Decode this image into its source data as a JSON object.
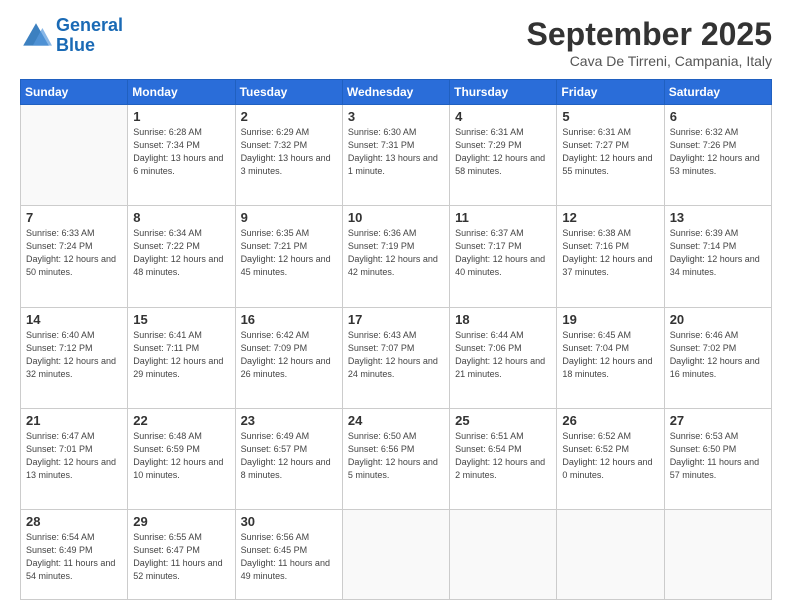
{
  "logo": {
    "line1": "General",
    "line2": "Blue"
  },
  "title": "September 2025",
  "location": "Cava De Tirreni, Campania, Italy",
  "days_of_week": [
    "Sunday",
    "Monday",
    "Tuesday",
    "Wednesday",
    "Thursday",
    "Friday",
    "Saturday"
  ],
  "weeks": [
    [
      {
        "day": "",
        "sunrise": "",
        "sunset": "",
        "daylight": ""
      },
      {
        "day": "1",
        "sunrise": "Sunrise: 6:28 AM",
        "sunset": "Sunset: 7:34 PM",
        "daylight": "Daylight: 13 hours and 6 minutes."
      },
      {
        "day": "2",
        "sunrise": "Sunrise: 6:29 AM",
        "sunset": "Sunset: 7:32 PM",
        "daylight": "Daylight: 13 hours and 3 minutes."
      },
      {
        "day": "3",
        "sunrise": "Sunrise: 6:30 AM",
        "sunset": "Sunset: 7:31 PM",
        "daylight": "Daylight: 13 hours and 1 minute."
      },
      {
        "day": "4",
        "sunrise": "Sunrise: 6:31 AM",
        "sunset": "Sunset: 7:29 PM",
        "daylight": "Daylight: 12 hours and 58 minutes."
      },
      {
        "day": "5",
        "sunrise": "Sunrise: 6:31 AM",
        "sunset": "Sunset: 7:27 PM",
        "daylight": "Daylight: 12 hours and 55 minutes."
      },
      {
        "day": "6",
        "sunrise": "Sunrise: 6:32 AM",
        "sunset": "Sunset: 7:26 PM",
        "daylight": "Daylight: 12 hours and 53 minutes."
      }
    ],
    [
      {
        "day": "7",
        "sunrise": "Sunrise: 6:33 AM",
        "sunset": "Sunset: 7:24 PM",
        "daylight": "Daylight: 12 hours and 50 minutes."
      },
      {
        "day": "8",
        "sunrise": "Sunrise: 6:34 AM",
        "sunset": "Sunset: 7:22 PM",
        "daylight": "Daylight: 12 hours and 48 minutes."
      },
      {
        "day": "9",
        "sunrise": "Sunrise: 6:35 AM",
        "sunset": "Sunset: 7:21 PM",
        "daylight": "Daylight: 12 hours and 45 minutes."
      },
      {
        "day": "10",
        "sunrise": "Sunrise: 6:36 AM",
        "sunset": "Sunset: 7:19 PM",
        "daylight": "Daylight: 12 hours and 42 minutes."
      },
      {
        "day": "11",
        "sunrise": "Sunrise: 6:37 AM",
        "sunset": "Sunset: 7:17 PM",
        "daylight": "Daylight: 12 hours and 40 minutes."
      },
      {
        "day": "12",
        "sunrise": "Sunrise: 6:38 AM",
        "sunset": "Sunset: 7:16 PM",
        "daylight": "Daylight: 12 hours and 37 minutes."
      },
      {
        "day": "13",
        "sunrise": "Sunrise: 6:39 AM",
        "sunset": "Sunset: 7:14 PM",
        "daylight": "Daylight: 12 hours and 34 minutes."
      }
    ],
    [
      {
        "day": "14",
        "sunrise": "Sunrise: 6:40 AM",
        "sunset": "Sunset: 7:12 PM",
        "daylight": "Daylight: 12 hours and 32 minutes."
      },
      {
        "day": "15",
        "sunrise": "Sunrise: 6:41 AM",
        "sunset": "Sunset: 7:11 PM",
        "daylight": "Daylight: 12 hours and 29 minutes."
      },
      {
        "day": "16",
        "sunrise": "Sunrise: 6:42 AM",
        "sunset": "Sunset: 7:09 PM",
        "daylight": "Daylight: 12 hours and 26 minutes."
      },
      {
        "day": "17",
        "sunrise": "Sunrise: 6:43 AM",
        "sunset": "Sunset: 7:07 PM",
        "daylight": "Daylight: 12 hours and 24 minutes."
      },
      {
        "day": "18",
        "sunrise": "Sunrise: 6:44 AM",
        "sunset": "Sunset: 7:06 PM",
        "daylight": "Daylight: 12 hours and 21 minutes."
      },
      {
        "day": "19",
        "sunrise": "Sunrise: 6:45 AM",
        "sunset": "Sunset: 7:04 PM",
        "daylight": "Daylight: 12 hours and 18 minutes."
      },
      {
        "day": "20",
        "sunrise": "Sunrise: 6:46 AM",
        "sunset": "Sunset: 7:02 PM",
        "daylight": "Daylight: 12 hours and 16 minutes."
      }
    ],
    [
      {
        "day": "21",
        "sunrise": "Sunrise: 6:47 AM",
        "sunset": "Sunset: 7:01 PM",
        "daylight": "Daylight: 12 hours and 13 minutes."
      },
      {
        "day": "22",
        "sunrise": "Sunrise: 6:48 AM",
        "sunset": "Sunset: 6:59 PM",
        "daylight": "Daylight: 12 hours and 10 minutes."
      },
      {
        "day": "23",
        "sunrise": "Sunrise: 6:49 AM",
        "sunset": "Sunset: 6:57 PM",
        "daylight": "Daylight: 12 hours and 8 minutes."
      },
      {
        "day": "24",
        "sunrise": "Sunrise: 6:50 AM",
        "sunset": "Sunset: 6:56 PM",
        "daylight": "Daylight: 12 hours and 5 minutes."
      },
      {
        "day": "25",
        "sunrise": "Sunrise: 6:51 AM",
        "sunset": "Sunset: 6:54 PM",
        "daylight": "Daylight: 12 hours and 2 minutes."
      },
      {
        "day": "26",
        "sunrise": "Sunrise: 6:52 AM",
        "sunset": "Sunset: 6:52 PM",
        "daylight": "Daylight: 12 hours and 0 minutes."
      },
      {
        "day": "27",
        "sunrise": "Sunrise: 6:53 AM",
        "sunset": "Sunset: 6:50 PM",
        "daylight": "Daylight: 11 hours and 57 minutes."
      }
    ],
    [
      {
        "day": "28",
        "sunrise": "Sunrise: 6:54 AM",
        "sunset": "Sunset: 6:49 PM",
        "daylight": "Daylight: 11 hours and 54 minutes."
      },
      {
        "day": "29",
        "sunrise": "Sunrise: 6:55 AM",
        "sunset": "Sunset: 6:47 PM",
        "daylight": "Daylight: 11 hours and 52 minutes."
      },
      {
        "day": "30",
        "sunrise": "Sunrise: 6:56 AM",
        "sunset": "Sunset: 6:45 PM",
        "daylight": "Daylight: 11 hours and 49 minutes."
      },
      {
        "day": "",
        "sunrise": "",
        "sunset": "",
        "daylight": ""
      },
      {
        "day": "",
        "sunrise": "",
        "sunset": "",
        "daylight": ""
      },
      {
        "day": "",
        "sunrise": "",
        "sunset": "",
        "daylight": ""
      },
      {
        "day": "",
        "sunrise": "",
        "sunset": "",
        "daylight": ""
      }
    ]
  ]
}
